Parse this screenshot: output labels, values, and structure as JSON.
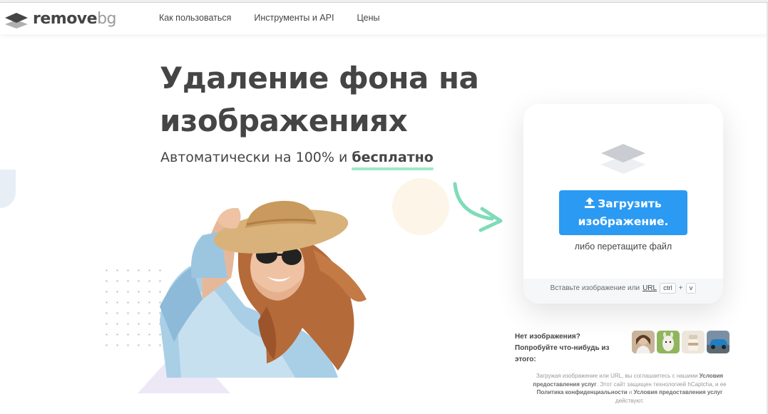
{
  "header": {
    "logo_remove": "remove",
    "logo_bg": "bg",
    "nav": [
      "Как пользоваться",
      "Инструменты и API",
      "Цены"
    ]
  },
  "hero": {
    "title": "Удаление фона на изображениях",
    "subtitle_prefix": "Автоматически на 100% и ",
    "subtitle_emphasis": "бесплатно"
  },
  "upload_card": {
    "button_label": "Загрузить изображение.",
    "drop_text": "либо перетащите файл",
    "paste_prefix": "Вставьте изображение или",
    "paste_link": "URL",
    "key_ctrl": "ctrl",
    "key_plus": "+",
    "key_v": "v"
  },
  "samples": {
    "prompt": "Нет изображения? Попробуйте что-нибудь из этого:",
    "items": [
      "sample-woman",
      "sample-llama",
      "sample-cup",
      "sample-car"
    ]
  },
  "legal": {
    "part1": "Загружая изображение или URL, вы соглашаетесь с нашими ",
    "terms": "Условия предоставления услуг",
    "part2": ". Этот сайт защищен технологией hCaptcha, и ее ",
    "privacy": "Политика конфиденциальности",
    "part3": " и ",
    "terms2": "Условия предоставления услуг",
    "part4": " действуют."
  },
  "colors": {
    "accent": "#2b9af3",
    "text": "#454545",
    "highlight": "#9fe8c8",
    "arrow": "#7fdcb8"
  },
  "icons": [
    "logo-layers-icon",
    "layers-icon",
    "upload-arrow-icon",
    "curved-arrow-icon"
  ]
}
